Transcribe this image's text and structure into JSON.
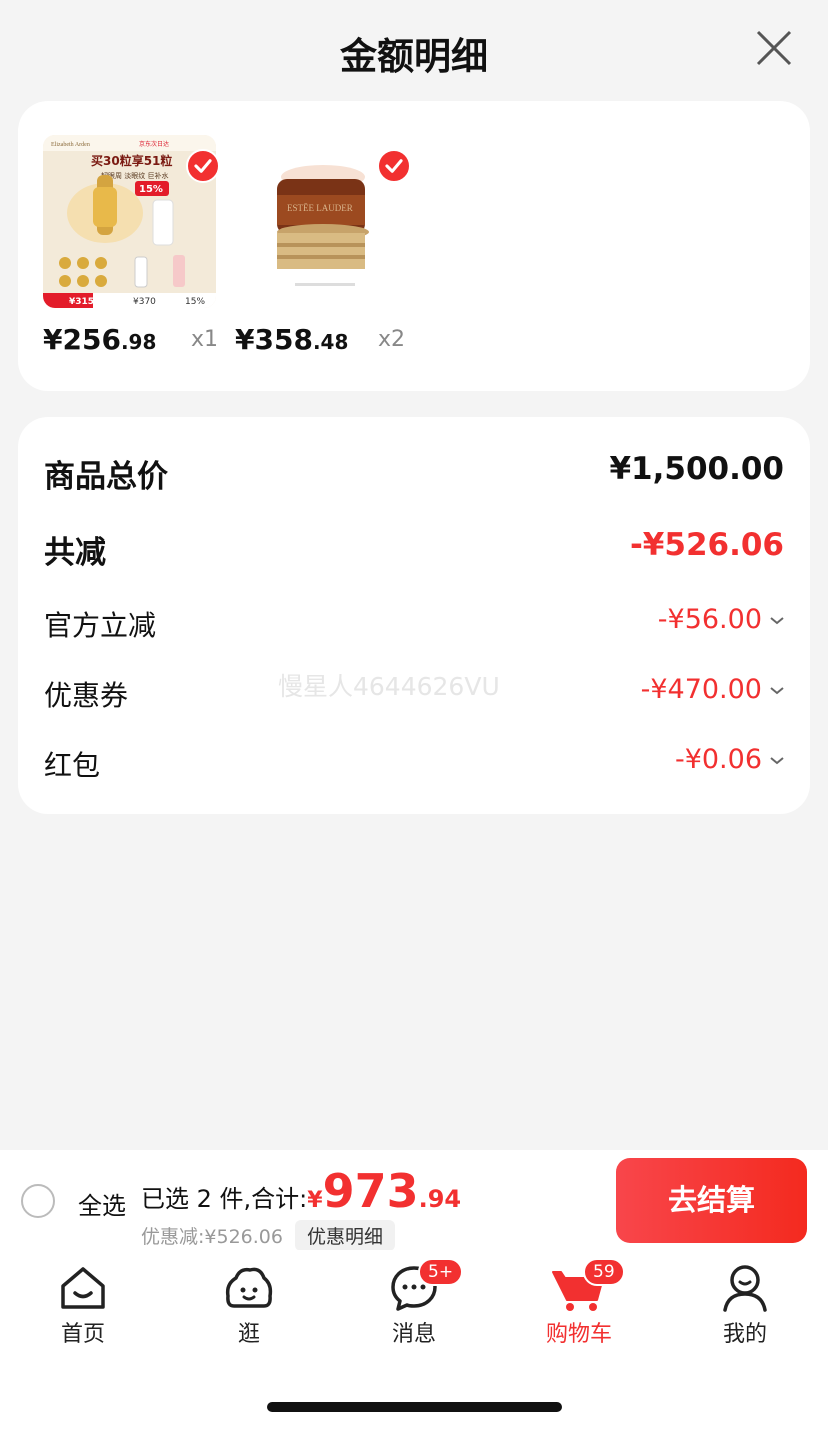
{
  "header": {
    "title": "金额明细"
  },
  "products": [
    {
      "price_int": "¥256",
      "price_dec": ".98",
      "qty": "x1",
      "thumb_text": {
        "brand": "Elizabeth Arden",
        "shop": "京东次日达",
        "promo": "买30粒享51粒",
        "sub": "韧眼周 淡眼纹 巨补水",
        "badge": "15%",
        "price_tag": "¥315",
        "price_tag2": "¥370",
        "pct2": "15%"
      }
    },
    {
      "price_int": "¥358",
      "price_dec": ".48",
      "qty": "x2",
      "thumb_text": {
        "brand": "ESTĒE LAUDER"
      }
    }
  ],
  "summary": {
    "total_label": "商品总价",
    "total_value": "¥1,500.00",
    "reduce_label": "共减",
    "reduce_value": "-¥526.06",
    "items": [
      {
        "label": "官方立减",
        "value": "-¥56.00"
      },
      {
        "label": "优惠券",
        "value": "-¥470.00"
      },
      {
        "label": "红包",
        "value": "-¥0.06"
      }
    ],
    "watermark": "慢星人4644626VU"
  },
  "bottom_bar": {
    "select_all": "全选",
    "selected_text": "已选 2 件,合计:",
    "total_yen": "¥",
    "total_int": "973",
    "total_dec": ".94",
    "discount_text": "优惠减:¥526.06",
    "detail_chip": "优惠明细",
    "checkout": "去结算"
  },
  "tabs": [
    {
      "label": "首页",
      "icon": "home-icon"
    },
    {
      "label": "逛",
      "icon": "browse-icon"
    },
    {
      "label": "消息",
      "icon": "message-icon",
      "badge": "5+"
    },
    {
      "label": "购物车",
      "icon": "cart-icon",
      "badge": "59",
      "active": true
    },
    {
      "label": "我的",
      "icon": "profile-icon"
    }
  ],
  "colors": {
    "accent": "#f23030",
    "background": "#f4f4f4"
  }
}
